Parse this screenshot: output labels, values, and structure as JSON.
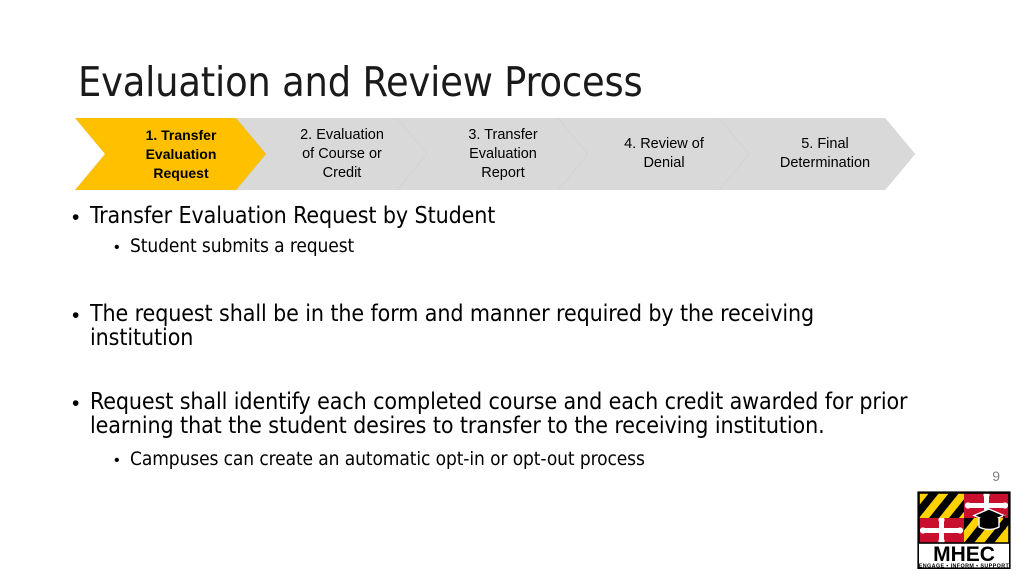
{
  "slide": {
    "title": "Evaluation and Review Process",
    "page_number": "9",
    "background_color": "#FFFFFF"
  },
  "process_flow": {
    "accent_color": "#FFC000",
    "inactive_color": "#D9D9D9",
    "outline_color": "#A6A6A6",
    "steps": [
      {
        "number": "1",
        "label": "1. Transfer\nEvaluation\nRequest",
        "state": "active",
        "fill": "#FFC000"
      },
      {
        "number": "2",
        "label": "2. Evaluation\nof Course or\nCredit",
        "state": "inactive",
        "fill": "#D9D9D9"
      },
      {
        "number": "3",
        "label": "3. Transfer\nEvaluation\nReport",
        "state": "inactive",
        "fill": "#D9D9D9"
      },
      {
        "number": "4",
        "label": "4. Review of\nDenial",
        "state": "inactive",
        "fill": "#D9D9D9"
      },
      {
        "number": "5",
        "label": "5. Final\nDetermination",
        "state": "inactive",
        "fill": "#D9D9D9"
      }
    ]
  },
  "content": {
    "blocks": [
      {
        "bullet": "Transfer Evaluation Request by Student",
        "sub_bullets": [
          "Student submits a request"
        ]
      },
      {
        "bullet": "The request shall be in the form and manner required by the receiving institution",
        "sub_bullets": []
      },
      {
        "bullet": "Request shall identify each completed course and each credit awarded for prior learning that the student desires to transfer to the receiving institution.",
        "sub_bullets": [
          "Campuses can create an automatic opt-in or opt-out process"
        ]
      }
    ],
    "bullet_glyph": "•"
  },
  "logo": {
    "name": "mhec-logo",
    "wordmark": "MHEC",
    "tagline": "ENGAGE • INFORM • SUPPORT",
    "colors": {
      "gold": "#FFD200",
      "black": "#000000",
      "red": "#C8102E",
      "white": "#FFFFFF"
    }
  }
}
